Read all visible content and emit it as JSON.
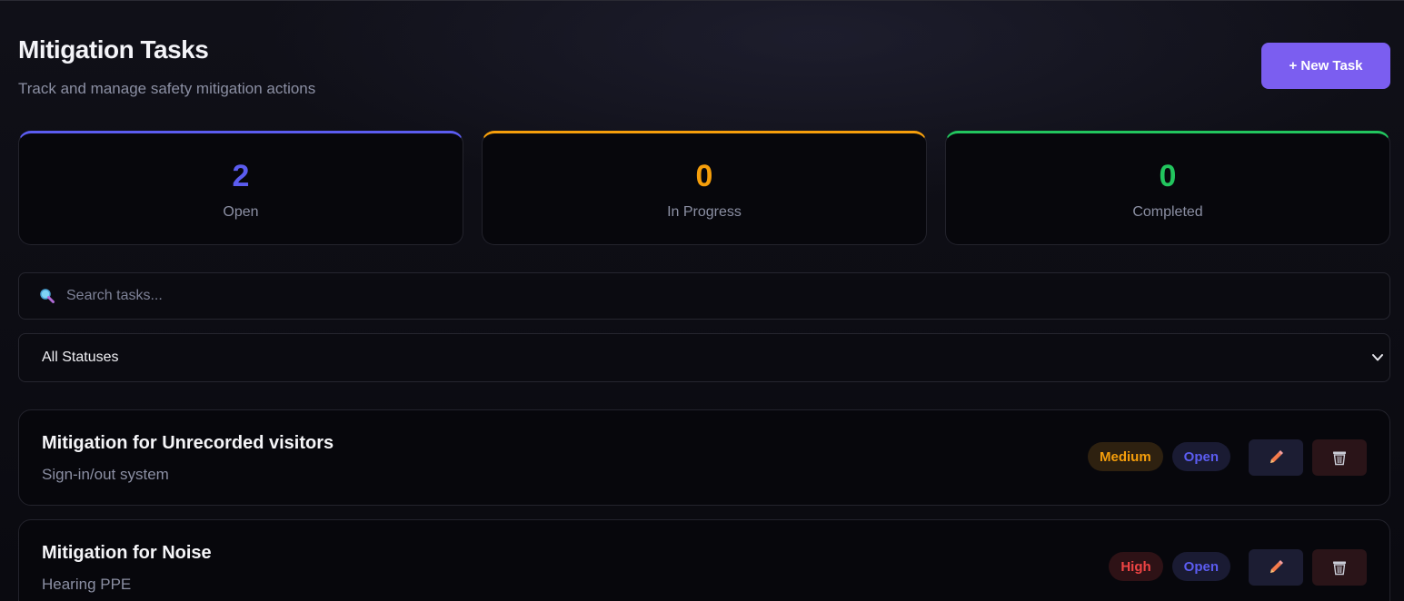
{
  "header": {
    "title": "Mitigation Tasks",
    "subtitle": "Track and manage safety mitigation actions",
    "new_task_label": "+ New Task"
  },
  "stats": [
    {
      "value": "2",
      "label": "Open",
      "color": "#5b5cf0"
    },
    {
      "value": "0",
      "label": "In Progress",
      "color": "#f59e0b"
    },
    {
      "value": "0",
      "label": "Completed",
      "color": "#22c55e"
    }
  ],
  "search": {
    "placeholder": "Search tasks...",
    "value": "",
    "icon": "search-icon"
  },
  "status_filter": {
    "selected": "All Statuses"
  },
  "tasks": [
    {
      "title": "Mitigation for Unrecorded visitors",
      "description": "Sign-in/out system",
      "priority": "Medium",
      "status": "Open"
    },
    {
      "title": "Mitigation for Noise",
      "description": "Hearing PPE",
      "priority": "High",
      "status": "Open"
    }
  ],
  "colors": {
    "accent": "#7b5ef0",
    "priority_medium_text": "#f59e0b",
    "priority_medium_bg": "#2e2110",
    "priority_high_text": "#ef4444",
    "priority_high_bg": "#2e1216",
    "status_open_text": "#5b5cf0",
    "status_open_bg": "#1a1b33"
  }
}
